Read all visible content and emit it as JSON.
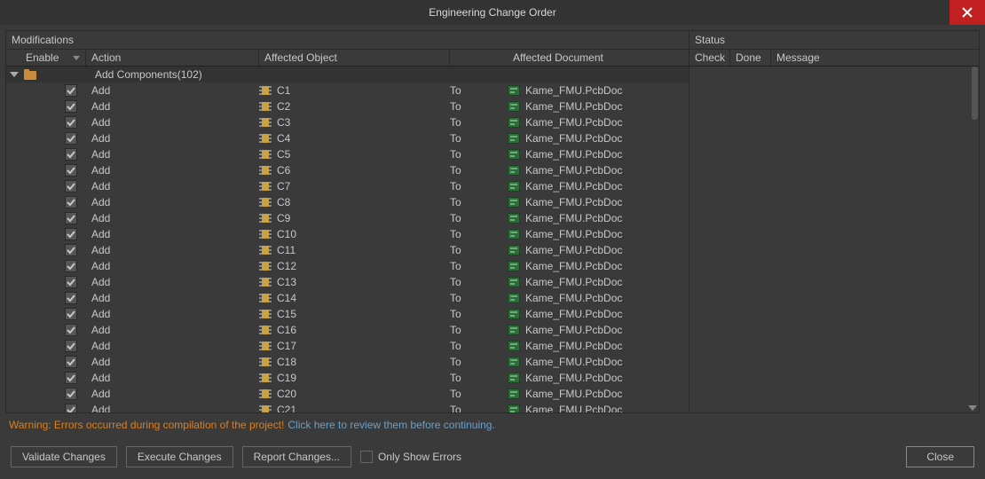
{
  "title": "Engineering Change Order",
  "panels": {
    "left_title": "Modifications",
    "right_title": "Status"
  },
  "headers": {
    "enable": "Enable",
    "action": "Action",
    "affected_object": "Affected Object",
    "affected_document": "Affected Document",
    "check": "Check",
    "done": "Done",
    "message": "Message"
  },
  "group": {
    "label": "Add Components(102)"
  },
  "rows": [
    {
      "enabled": true,
      "action": "Add",
      "object": "C1",
      "to": "To",
      "document": "Kame_FMU.PcbDoc"
    },
    {
      "enabled": true,
      "action": "Add",
      "object": "C2",
      "to": "To",
      "document": "Kame_FMU.PcbDoc"
    },
    {
      "enabled": true,
      "action": "Add",
      "object": "C3",
      "to": "To",
      "document": "Kame_FMU.PcbDoc"
    },
    {
      "enabled": true,
      "action": "Add",
      "object": "C4",
      "to": "To",
      "document": "Kame_FMU.PcbDoc"
    },
    {
      "enabled": true,
      "action": "Add",
      "object": "C5",
      "to": "To",
      "document": "Kame_FMU.PcbDoc"
    },
    {
      "enabled": true,
      "action": "Add",
      "object": "C6",
      "to": "To",
      "document": "Kame_FMU.PcbDoc"
    },
    {
      "enabled": true,
      "action": "Add",
      "object": "C7",
      "to": "To",
      "document": "Kame_FMU.PcbDoc"
    },
    {
      "enabled": true,
      "action": "Add",
      "object": "C8",
      "to": "To",
      "document": "Kame_FMU.PcbDoc"
    },
    {
      "enabled": true,
      "action": "Add",
      "object": "C9",
      "to": "To",
      "document": "Kame_FMU.PcbDoc"
    },
    {
      "enabled": true,
      "action": "Add",
      "object": "C10",
      "to": "To",
      "document": "Kame_FMU.PcbDoc"
    },
    {
      "enabled": true,
      "action": "Add",
      "object": "C11",
      "to": "To",
      "document": "Kame_FMU.PcbDoc"
    },
    {
      "enabled": true,
      "action": "Add",
      "object": "C12",
      "to": "To",
      "document": "Kame_FMU.PcbDoc"
    },
    {
      "enabled": true,
      "action": "Add",
      "object": "C13",
      "to": "To",
      "document": "Kame_FMU.PcbDoc"
    },
    {
      "enabled": true,
      "action": "Add",
      "object": "C14",
      "to": "To",
      "document": "Kame_FMU.PcbDoc"
    },
    {
      "enabled": true,
      "action": "Add",
      "object": "C15",
      "to": "To",
      "document": "Kame_FMU.PcbDoc"
    },
    {
      "enabled": true,
      "action": "Add",
      "object": "C16",
      "to": "To",
      "document": "Kame_FMU.PcbDoc"
    },
    {
      "enabled": true,
      "action": "Add",
      "object": "C17",
      "to": "To",
      "document": "Kame_FMU.PcbDoc"
    },
    {
      "enabled": true,
      "action": "Add",
      "object": "C18",
      "to": "To",
      "document": "Kame_FMU.PcbDoc"
    },
    {
      "enabled": true,
      "action": "Add",
      "object": "C19",
      "to": "To",
      "document": "Kame_FMU.PcbDoc"
    },
    {
      "enabled": true,
      "action": "Add",
      "object": "C20",
      "to": "To",
      "document": "Kame_FMU.PcbDoc"
    },
    {
      "enabled": true,
      "action": "Add",
      "object": "C21",
      "to": "To",
      "document": "Kame_FMU.PcbDoc"
    }
  ],
  "warning": {
    "text": "Warning: Errors occurred during compilation of the project!",
    "link": "Click here to review them before continuing."
  },
  "footer": {
    "validate": "Validate Changes",
    "execute": "Execute Changes",
    "report": "Report Changes...",
    "only_errors": "Only Show Errors",
    "close": "Close"
  }
}
